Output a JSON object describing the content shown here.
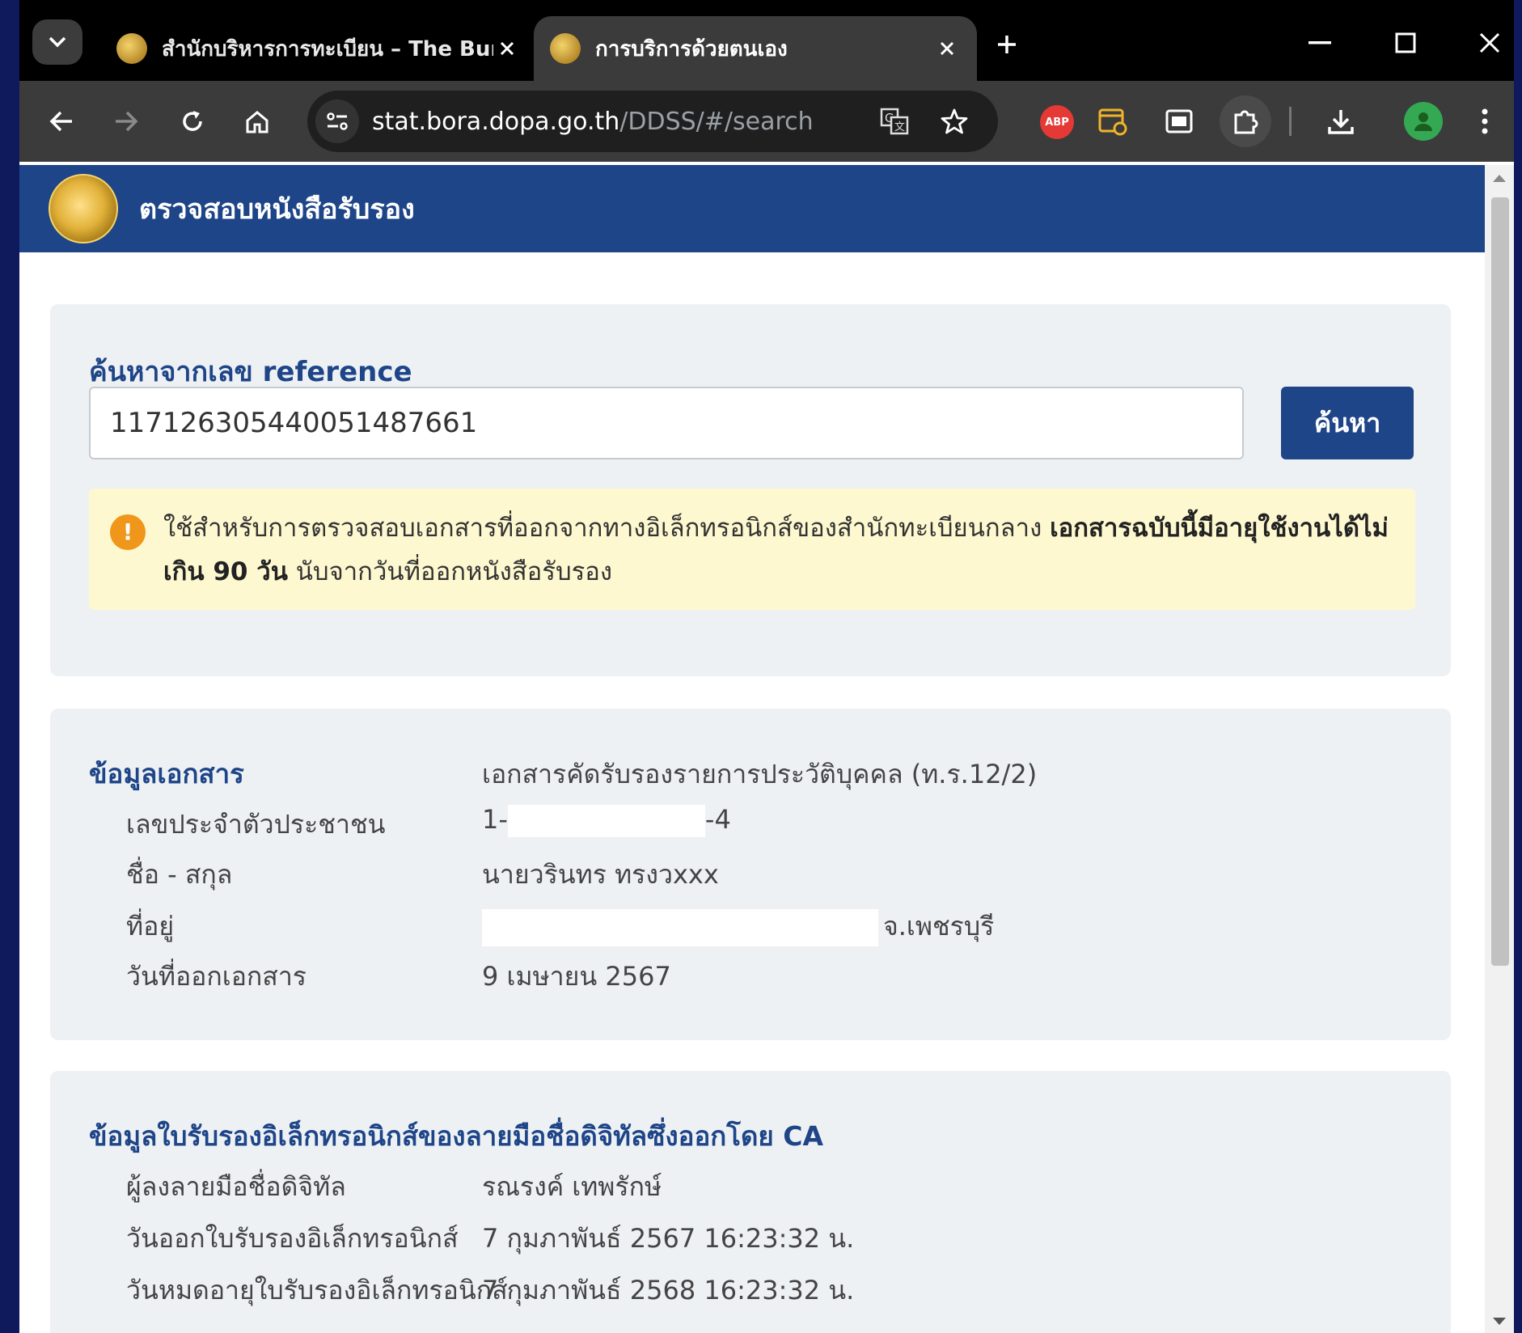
{
  "browser": {
    "tabs": [
      {
        "title": "สำนักบริหารการทะเบียน – The Bure",
        "active": false
      },
      {
        "title": "การบริการด้วยตนเอง",
        "active": true
      }
    ],
    "url_host": "stat.bora.dopa.go.th",
    "url_path": "/DDSS/#/search"
  },
  "header": {
    "title": "ตรวจสอบหนังสือรับรอง"
  },
  "search": {
    "label": "ค้นหาจากเลข reference",
    "value": "117126305440051487661",
    "button_label": "ค้นหา"
  },
  "notice": {
    "text_normal": "ใช้สำหรับการตรวจสอบเอกสารที่ออกจากทางอิเล็กทรอนิกส์ของสำนักทะเบียนกลาง ",
    "text_bold": "เอกสารฉบับนี้มีอายุใช้งานได้ไม่เกิน 90 วัน",
    "text_end": " นับจากวันที่ออกหนังสือรับรอง"
  },
  "document_info": {
    "title": "ข้อมูลเอกสาร",
    "document_type": "เอกสารคัดรับรองรายการประวัติบุคคล (ท.ร.12/2)",
    "rows": [
      {
        "label": "เลขประจำตัวประชาชน",
        "value_start": "1-",
        "value_end": "-4"
      },
      {
        "label": "ชื่อ - สกุล",
        "value": "นายวรินทร ทรงวxxx"
      },
      {
        "label": "ที่อยู่",
        "value": "จ.เพชรบุรี"
      },
      {
        "label": "วันที่ออกเอกสาร",
        "value": "9 เมษายน 2567"
      }
    ]
  },
  "ca_info": {
    "title": "ข้อมูลใบรับรองอิเล็กทรอนิกส์ของลายมือชื่อดิจิทัลซึ่งออกโดย CA",
    "rows": [
      {
        "label": "ผู้ลงลายมือชื่อดิจิทัล",
        "value": "รณรงค์ เทพรักษ์"
      },
      {
        "label": "วันออกใบรับรองอิเล็กทรอนิกส์",
        "value": "7 กุมภาพันธ์ 2567 16:23:32 น."
      },
      {
        "label": "วันหมดอายุใบรับรองอิเล็กทรอนิกส์",
        "value": "7 กุมภาพันธ์ 2568 16:23:32 น."
      }
    ]
  },
  "colors": {
    "brand_blue": "#1e4588",
    "notice_bg": "#fdf8cf",
    "info_orange": "#f0961a",
    "card_bg": "#eef1f4"
  },
  "icons": [
    "tab-search-icon",
    "close-icon",
    "new-tab-icon",
    "minimize-icon",
    "maximize-icon",
    "back-icon",
    "forward-icon",
    "reload-icon",
    "home-icon",
    "site-info-icon",
    "translate-icon",
    "bookmark-star-icon",
    "adblock-icon",
    "extension-icon",
    "picture-in-picture-icon",
    "extensions-puzzle-icon",
    "download-icon",
    "profile-icon",
    "menu-kebab-icon",
    "info-icon",
    "emblem-icon"
  ]
}
